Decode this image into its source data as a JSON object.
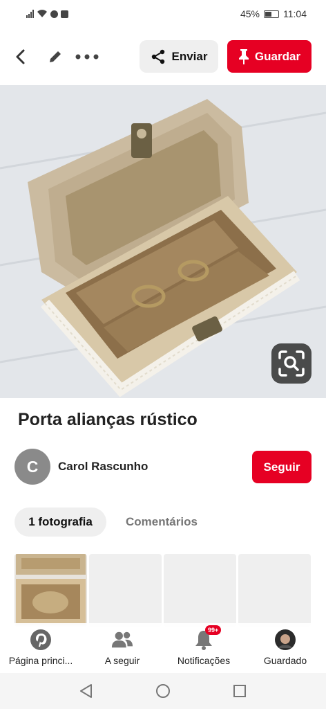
{
  "status_bar": {
    "battery": "45%",
    "time": "11:04"
  },
  "toolbar": {
    "send_label": "Enviar",
    "save_label": "Guardar"
  },
  "pin": {
    "title": "Porta alianças rústico",
    "author_initial": "C",
    "author_name": "Carol Rascunho",
    "follow_label": "Seguir"
  },
  "tabs": [
    {
      "label": "1 fotografia",
      "active": true
    },
    {
      "label": "Comentários",
      "active": false
    }
  ],
  "bottom_nav": {
    "items": [
      {
        "label": "Página princi...",
        "icon": "pinterest-icon"
      },
      {
        "label": "A seguir",
        "icon": "people-icon"
      },
      {
        "label": "Notificações",
        "icon": "bell-icon",
        "badge": "99+"
      },
      {
        "label": "Guardado",
        "icon": "profile-avatar"
      }
    ]
  },
  "colors": {
    "brand_red": "#e60023",
    "light_button": "#efefef"
  }
}
